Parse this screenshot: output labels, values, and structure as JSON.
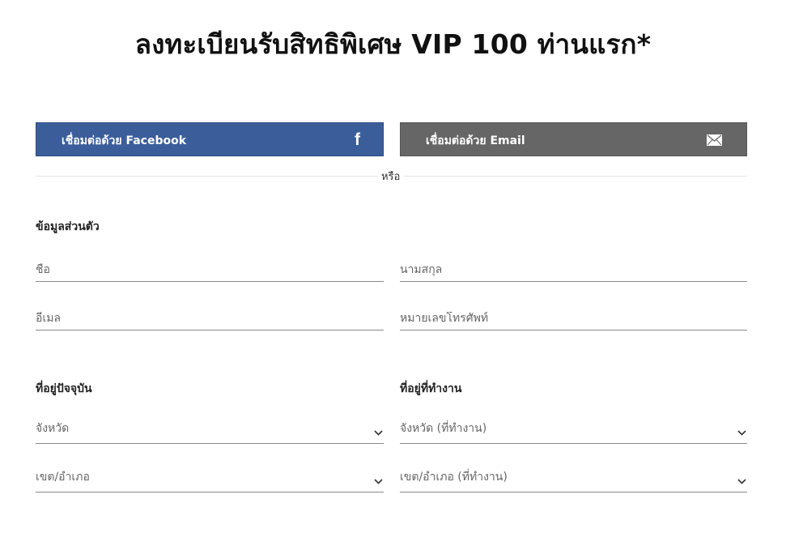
{
  "page": {
    "title": "ลงทะเบียนรับสิทธิพิเศษ VIP 100 ท่านแรก*"
  },
  "social": {
    "facebook_label": "เชื่อมต่อด้วย Facebook",
    "facebook_color": "#3b5e9b",
    "facebook_icon": "facebook-icon",
    "email_label": "เชื่อมต่อด้วย Email",
    "email_color": "#666666",
    "email_icon": "envelope-icon"
  },
  "divider": {
    "or_text": "หรือ"
  },
  "personal": {
    "heading": "ข้อมูลส่วนตัว",
    "first_name_placeholder": "ชื่อ",
    "last_name_placeholder": "นามสกุล",
    "email_placeholder": "อีเมล",
    "phone_placeholder": "หมายเลขโทรศัพท์"
  },
  "current_address": {
    "heading": "ที่อยู่ปัจจุบัน",
    "province_label": "จังหวัด",
    "district_label": "เขต/อำเภอ"
  },
  "work_address": {
    "heading": "ที่อยู่ที่ทำงาน",
    "province_label": "จังหวัด (ที่ทำงาน)",
    "district_label": "เขต/อำเภอ (ที่ทำงาน)"
  }
}
